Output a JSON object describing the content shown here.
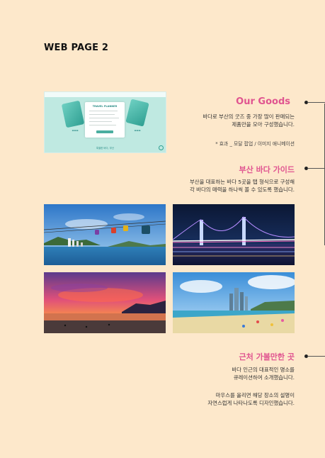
{
  "page": {
    "title": "WEB PAGE 2"
  },
  "goods": {
    "title": "Our Goods",
    "desc_line1": "바다로 부산의 굿즈 중 가장 많이 판매되는",
    "desc_line2": "제품만을 모아 구성했습니다.",
    "note": "* 효과 _ 모달 팝업 / 이미지 애니메이션",
    "mockup": {
      "modal_title": "TRAVEL PLANNER",
      "footer_text": "특별한 바다, 부산"
    }
  },
  "sea_guide": {
    "title": "부산 바다 가이드",
    "desc_line1": "부산을 대표하는 바다 5곳을 탭 형식으로 구성해",
    "desc_line2": "각 바다의 매력을 하나씩 볼 수 있도록 했습니다."
  },
  "nearby": {
    "title": "근처 가볼만한 곳",
    "desc_line1": "바다 인근의 대표적인 명소를",
    "desc_line2": "큐레이션하여 소개했습니다.",
    "desc_line3": "마우스를 올리면 해당 장소의 설명이",
    "desc_line4": "자연스럽게 나타나도록 디자인했습니다."
  },
  "colors": {
    "background": "#fde8cb",
    "accent": "#e05490"
  }
}
